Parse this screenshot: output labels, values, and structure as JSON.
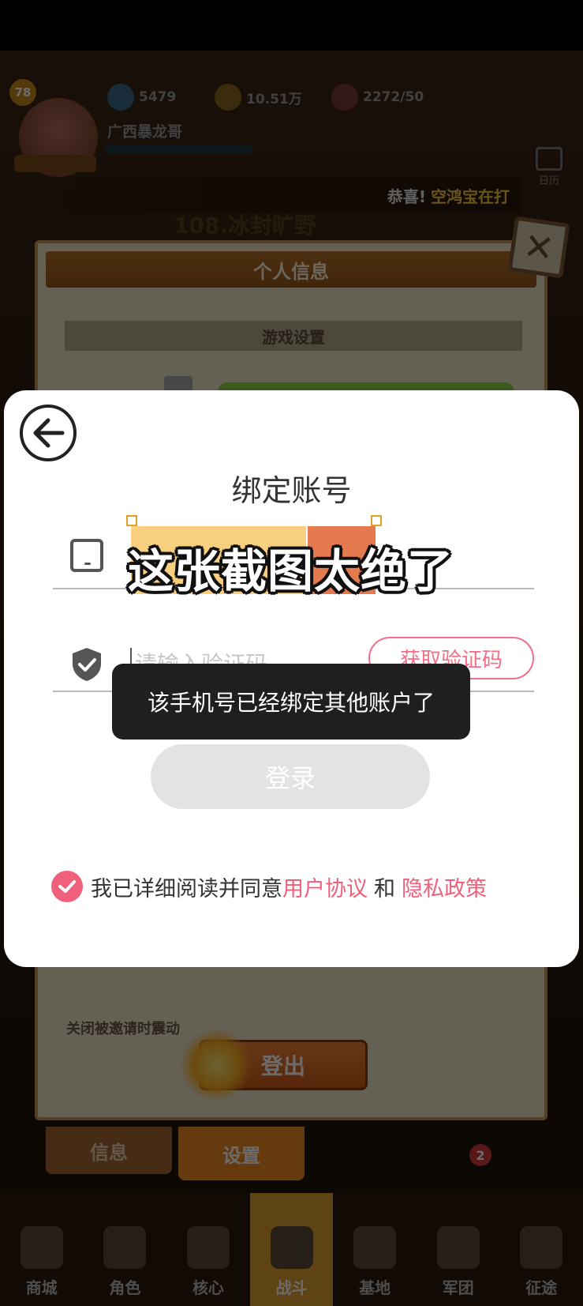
{
  "hud": {
    "level": "78",
    "player_name": "广西暴龙哥",
    "resources": [
      "5479",
      "10.51万",
      "2272/50"
    ],
    "calendar_label": "日历"
  },
  "marquee": {
    "prefix": "恭喜!",
    "text": "空鸿宝在打"
  },
  "stage_title": "108.冰封旷野",
  "panel": {
    "title": "个人信息",
    "section_title": "游戏设置",
    "hint": "关闭被邀请时震动",
    "logout_label": "登出",
    "tabs": {
      "info": "信息",
      "settings": "设置"
    }
  },
  "navbar": {
    "items": [
      "商城",
      "角色",
      "核心",
      "战斗",
      "基地",
      "军团",
      "征途"
    ],
    "active": "战斗",
    "badge": "2"
  },
  "dialog": {
    "title": "绑定账号",
    "code_placeholder": "请输入验证码",
    "get_code_label": "获取验证码",
    "login_label": "登录",
    "agree_text": "我已详细阅读并同意",
    "user_agreement": "用户协议",
    "and_text": "和",
    "privacy_policy": "隐私政策"
  },
  "toast": "该手机号已经绑定其他账户了",
  "caption": "这张截图太绝了",
  "colors": {
    "accent_pink": "#f0607a",
    "toast_bg": "#1f1f1f",
    "login_disabled": "#e3e3e3"
  }
}
